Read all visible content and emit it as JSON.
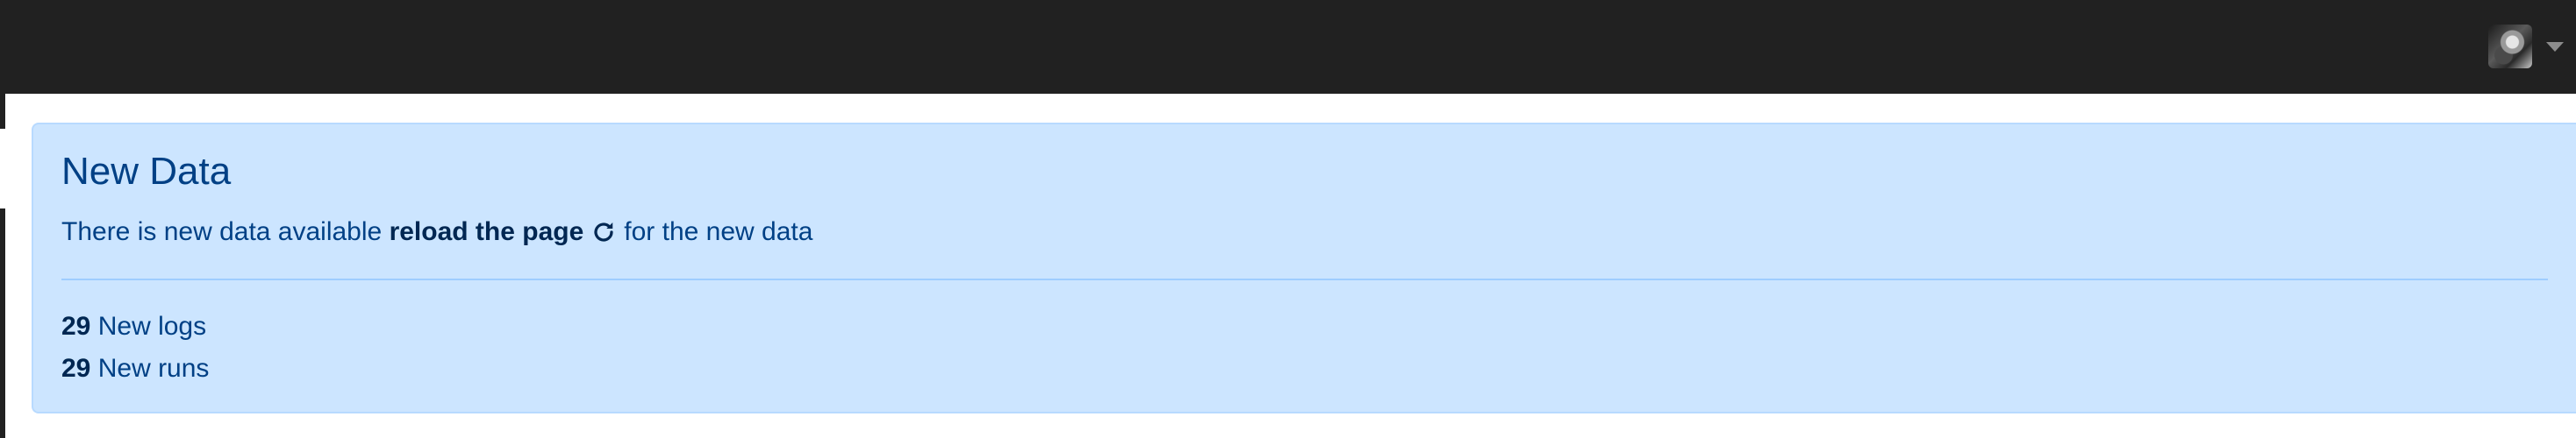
{
  "header": {
    "user_menu": {
      "avatar_icon": "user-avatar",
      "caret_icon": "caret-down-icon"
    },
    "colors": {
      "background": "#212121"
    }
  },
  "alert": {
    "heading": "New Data",
    "message_prefix": "There is new data available",
    "reload_link": "reload the page",
    "reload_icon": "reload-icon",
    "message_suffix": "for the new data",
    "stats": [
      {
        "count": "29",
        "label": "New logs"
      },
      {
        "count": "29",
        "label": "New runs"
      }
    ],
    "colors": {
      "background": "#cce5ff",
      "border": "#b8daff",
      "text": "#004085"
    }
  }
}
